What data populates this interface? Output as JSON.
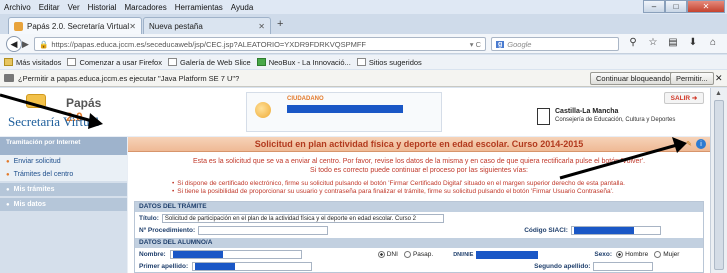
{
  "menu": [
    "Archivo",
    "Editar",
    "Ver",
    "Historial",
    "Marcadores",
    "Herramientas",
    "Ayuda"
  ],
  "tabs": [
    {
      "label": "Papás 2.0. Secretaría Virtual",
      "active": true
    },
    {
      "label": "Nueva pestaña",
      "active": false
    }
  ],
  "navbar": {
    "url": "https://papas.educa.jccm.es/seceducaweb/jsp/CEC.jsp?ALEATORIO=YXDR9FDRKVQSPMFF",
    "search_placeholder": "Google"
  },
  "bookmarks": [
    "Más visitados",
    "Comenzar a usar Firefox",
    "Galería de Web Slice",
    "NeoBux - La Innovació...",
    "Sitios sugeridos"
  ],
  "notification": {
    "text": "¿Permitir a papas.educa.jccm.es ejecutar \"Java Platform SE 7 U\"?",
    "continue_label": "Continuar bloqueando",
    "permit_label": "Permitir..."
  },
  "header": {
    "app_title": "Papás",
    "app_version": "2.0",
    "app_subtitle": "Secretaría Virtual",
    "citizen_label": "CIUDADANO",
    "org_line1": "Castilla-La Mancha",
    "org_line2": "Consejería de Educación, Cultura y Deportes",
    "exit_label": "SALIR"
  },
  "sidebar": {
    "section1": "Tramitación por Internet",
    "items": [
      "Enviar solicitud",
      "Trámites del centro"
    ],
    "section2": "Mis trámites",
    "section3": "Mis datos"
  },
  "content": {
    "title": "Solicitud en plan actividad física y deporte en edad escolar. Curso 2014-2015",
    "intro1": "Esta es la solicitud que se va a enviar al centro. Por favor, revise los datos de la misma y en caso de que quiera rectificarla pulse el botón 'Volver'.",
    "intro2": "Si todo es correcto puede continuar el proceso por las siguientes vías:",
    "note1": "Si dispone de certificado electrónico, firme su solicitud pulsando el botón 'Firmar Certificado Digital' situado en el margen superior derecho de esta pantalla.",
    "note2": "Si tiene la posibilidad de proporcionar su usuario y contraseña para finalizar el trámite, firme su solicitud pulsando el botón 'Firmar Usuario Contraseña'."
  },
  "form": {
    "sec_tramite": "DATOS DEL TRÁMITE",
    "titulo_label": "Título:",
    "titulo_value": "Solicitud de participación en el plan de la actividad física y el deporte en edad escolar. Curso 2",
    "procedimiento_label": "Nº Procedimiento:",
    "siaci_label": "Código SIACI:",
    "sec_alumno": "DATOS DEL ALUMNO/A",
    "nombre_label": "Nombre:",
    "dni_label": "DNI",
    "pasap_label": "Pasap.",
    "dninie_label": "DNI/NIE",
    "sexo_label": "Sexo:",
    "hombre_label": "Hombre",
    "mujer_label": "Mujer",
    "apellido1_label": "Primer apellido:",
    "apellido2_label": "Segundo apellido:"
  }
}
